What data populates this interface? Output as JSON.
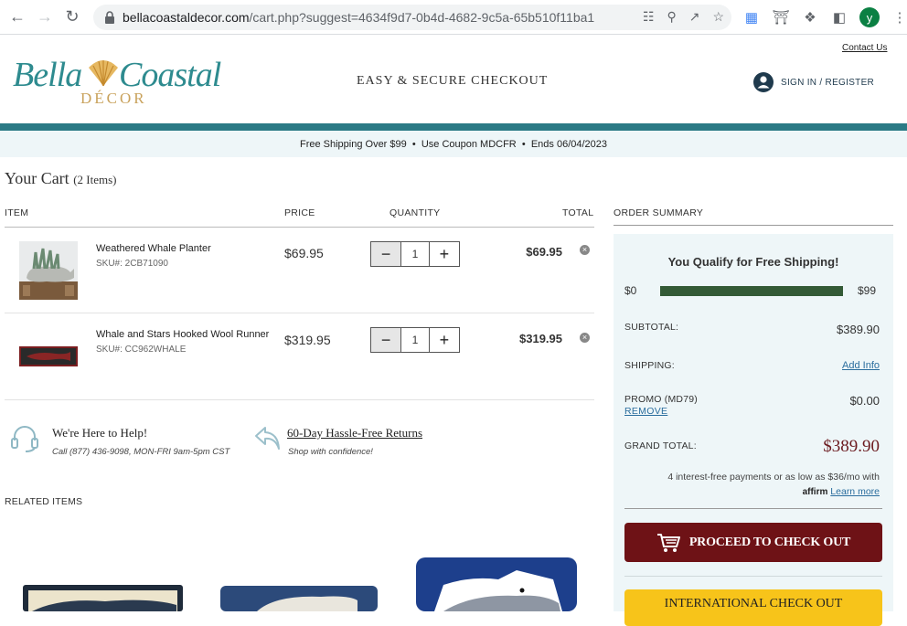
{
  "browser": {
    "url_host": "bellacoastaldecor.com",
    "url_path": "/cart.php?suggest=4634f9d7-0b4d-4682-9c5a-65b510f11ba1",
    "profile_initial": "y"
  },
  "header": {
    "contact_label": "Contact Us",
    "logo_word1": "Bella",
    "logo_word2": "Coastal",
    "logo_word3": "DÉCOR",
    "checkout_title": "EASY & SECURE CHECKOUT",
    "signin_label": "SIGN IN / REGISTER"
  },
  "promo": {
    "text": "Free Shipping Over $99  •  Use Coupon MDCFR  •  Ends 06/04/2023"
  },
  "cart": {
    "title": "Your Cart",
    "count": "(2 Items)",
    "columns": {
      "item": "ITEM",
      "price": "PRICE",
      "quantity": "QUANTITY",
      "total": "TOTAL"
    },
    "items": [
      {
        "name": "Weathered Whale Planter",
        "sku": "SKU#: 2CB71090",
        "price": "$69.95",
        "qty": "1",
        "total": "$69.95"
      },
      {
        "name": "Whale and Stars Hooked Wool Runner",
        "sku": "SKU#: CC962WHALE",
        "price": "$319.95",
        "qty": "1",
        "total": "$319.95"
      }
    ],
    "qty_minus": "−",
    "qty_plus": "+",
    "remove_glyph": "×"
  },
  "help": {
    "title": "We're Here to Help!",
    "sub": "Call (877) 436-9098, MON-FRI 9am-5pm CST",
    "returns_title": "60-Day Hassle-Free Returns",
    "returns_sub": "Shop with confidence!"
  },
  "related": {
    "title": "RELATED ITEMS"
  },
  "summary": {
    "head": "ORDER SUMMARY",
    "qualify": "You Qualify for Free Shipping!",
    "progress_min": "$0",
    "progress_max": "$99",
    "progress_fraction": 1.0,
    "subtotal_label": "SUBTOTAL:",
    "subtotal_value": "$389.90",
    "shipping_label": "SHIPPING:",
    "shipping_link": "Add Info",
    "promo_label": "PROMO (MD79)",
    "promo_remove": "REMOVE",
    "promo_value": "$0.00",
    "grand_label": "GRAND TOTAL:",
    "grand_value": "$389.90",
    "affirm_text": "4 interest-free payments or as low as $36/mo with",
    "affirm_logo": "affirm",
    "affirm_learn": "Learn more",
    "proceed_label": "PROCEED TO CHECK OUT",
    "intl_label": "INTERNATIONAL CHECK OUT"
  },
  "colors": {
    "teal": "#2b7a85",
    "proceed": "#6e1216",
    "intl": "#f7c41a",
    "progress": "#335a36"
  }
}
